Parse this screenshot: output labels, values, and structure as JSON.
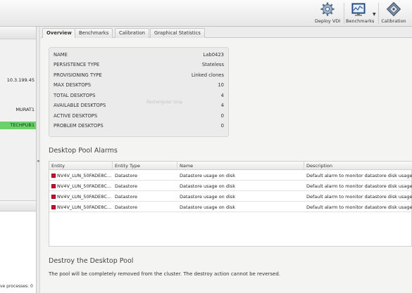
{
  "toolbar": {
    "buttons": [
      {
        "label": "Deploy VDI",
        "icon": "gear-icon"
      },
      {
        "label": "Benchmarks",
        "icon": "benchmark-chart-icon"
      },
      {
        "label": "Calibration",
        "icon": "calibration-icon"
      }
    ]
  },
  "left_panel": {
    "rows": [
      "10.3.199.45",
      "MURAT1",
      "TECHPUB1"
    ],
    "footer": "ve processes: 0"
  },
  "tabs": [
    "Overview",
    "Benchmarks",
    "Calibration",
    "Graphical Statistics"
  ],
  "properties": [
    {
      "key": "NAME",
      "value": "Lab0423"
    },
    {
      "key": "PERSISTENCE TYPE",
      "value": "Stateless"
    },
    {
      "key": "PROVISIONING TYPE",
      "value": "Linked clones"
    },
    {
      "key": "MAX DESKTOPS",
      "value": "10"
    },
    {
      "key": "TOTAL DESKTOPS",
      "value": "4"
    },
    {
      "key": "AVAILABLE DESKTOPS",
      "value": "4"
    },
    {
      "key": "ACTIVE DESKTOPS",
      "value": "0"
    },
    {
      "key": "PROBLEM DESKTOPS",
      "value": "0"
    }
  ],
  "ghost_text": "Rectangular Snip",
  "alarms": {
    "title": "Desktop Pool Alarms",
    "columns": [
      "Entity",
      "Entity Type",
      "Name",
      "Description"
    ],
    "rows": [
      [
        "NV4V_LUN_50FADE8C...",
        "Datastore",
        "Datastore usage on disk",
        "Default alarm to monitor datastore disk usage"
      ],
      [
        "NV4V_LUN_50FADE8C...",
        "Datastore",
        "Datastore usage on disk",
        "Default alarm to monitor datastore disk usage"
      ],
      [
        "NV4V_LUN_50FADE8C...",
        "Datastore",
        "Datastore usage on disk",
        "Default alarm to monitor datastore disk usage"
      ],
      [
        "NV4V_LUN_50FADE8C...",
        "Datastore",
        "Datastore usage on disk",
        "Default alarm to monitor datastore disk usage"
      ]
    ]
  },
  "destroy": {
    "title": "Destroy the Desktop Pool",
    "description": "The pool will be completely removed from the cluster. The destroy action cannot be reversed."
  },
  "colors": {
    "selected_row": "#6bd16b",
    "alarm": "#c8102e"
  }
}
